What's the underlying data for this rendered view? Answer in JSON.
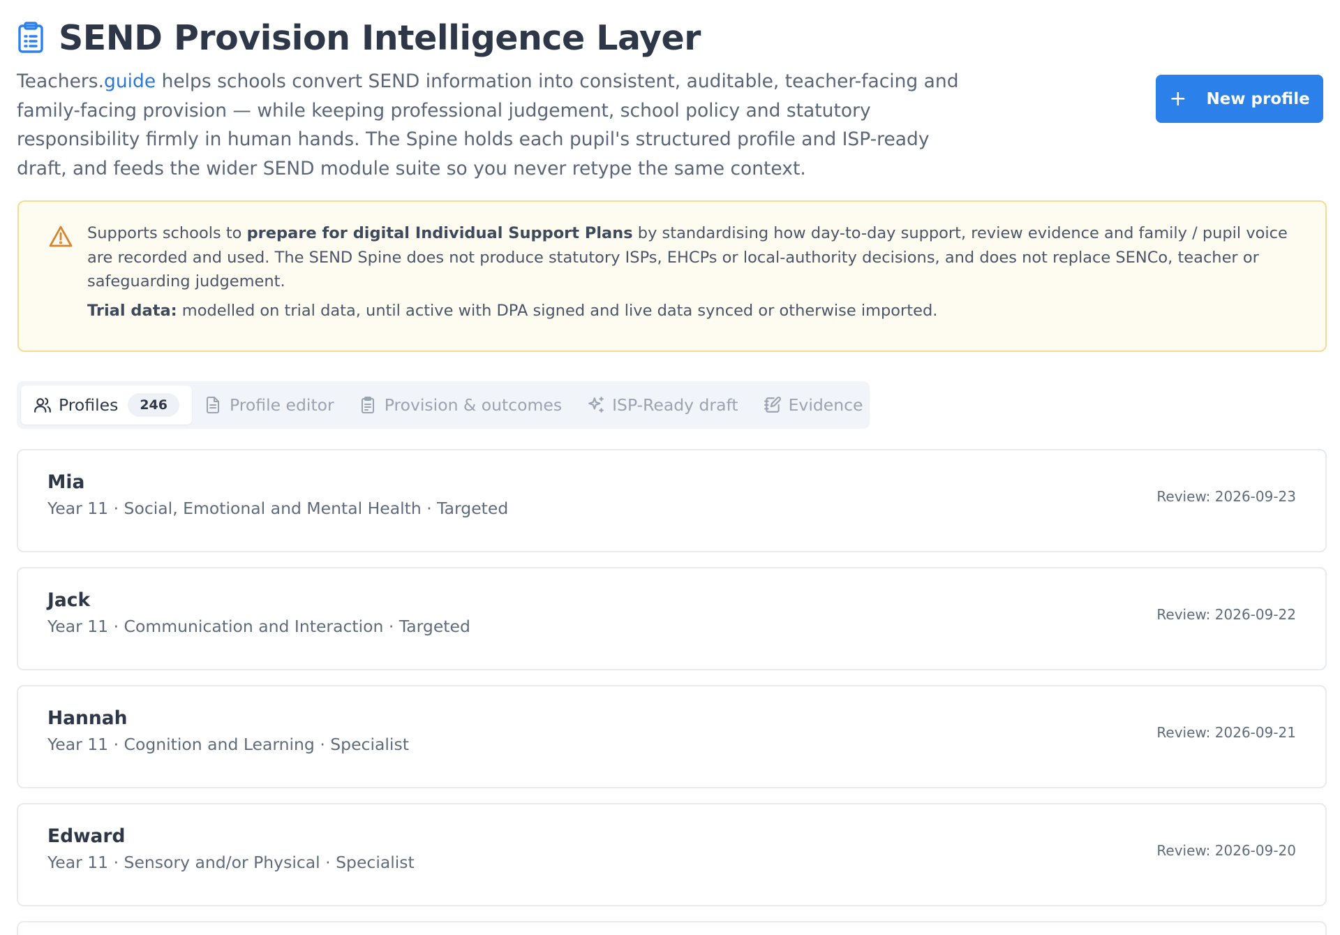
{
  "header": {
    "title": "SEND Provision Intelligence Layer",
    "title_icon": "clipboard-list-icon",
    "intro_prefix": "Teachers.",
    "intro_link": "guide",
    "intro_rest": " helps schools convert SEND information into consistent, auditable, teacher-facing and family-facing provision — while keeping professional judgement, school policy and statutory responsibility firmly in human hands. The Spine holds each pupil's structured profile and ISP-ready draft, and feeds the wider SEND module suite so you never retype the same context.",
    "new_button_label": "New profile",
    "new_button_icon": "plus-icon"
  },
  "notice": {
    "icon": "warning-triangle-icon",
    "line1_prefix": "Supports schools to ",
    "line1_bold": "prepare for digital Individual Support Plans",
    "line1_rest": " by standardising how day-to-day support, review evidence and family / pupil voice are recorded and used. The SEND Spine does not produce statutory ISPs, EHCPs or local-authority decisions, and does not replace SENCo, teacher or safeguarding judgement.",
    "line2_bold": "Trial data:",
    "line2_rest": " modelled on trial data, until active with DPA signed and live data synced or otherwise imported."
  },
  "tabs": [
    {
      "label": "Profiles",
      "icon": "users-icon",
      "badge": "246",
      "active": true
    },
    {
      "label": "Profile editor",
      "icon": "document-icon",
      "active": false
    },
    {
      "label": "Provision & outcomes",
      "icon": "clipboard-icon",
      "active": false
    },
    {
      "label": "ISP-Ready draft",
      "icon": "sparkles-icon",
      "active": false
    },
    {
      "label": "Evidence",
      "icon": "notebook-pen-icon",
      "active": false
    }
  ],
  "profiles": [
    {
      "name": "Mia",
      "meta": "Year 11 · Social, Emotional and Mental Health · Targeted",
      "review": "Review: 2026-09-23"
    },
    {
      "name": "Jack",
      "meta": "Year 11 · Communication and Interaction · Targeted",
      "review": "Review: 2026-09-22"
    },
    {
      "name": "Hannah",
      "meta": "Year 11 · Cognition and Learning · Specialist",
      "review": "Review: 2026-09-21"
    },
    {
      "name": "Edward",
      "meta": "Year 11 · Sensory and/or Physical · Specialist",
      "review": "Review: 2026-09-20"
    }
  ],
  "colors": {
    "accent": "#2b80ea",
    "link": "#2b78d6",
    "warning": "#d9822b",
    "notice_bg": "#fefcf0",
    "notice_border": "#f5dc95"
  }
}
